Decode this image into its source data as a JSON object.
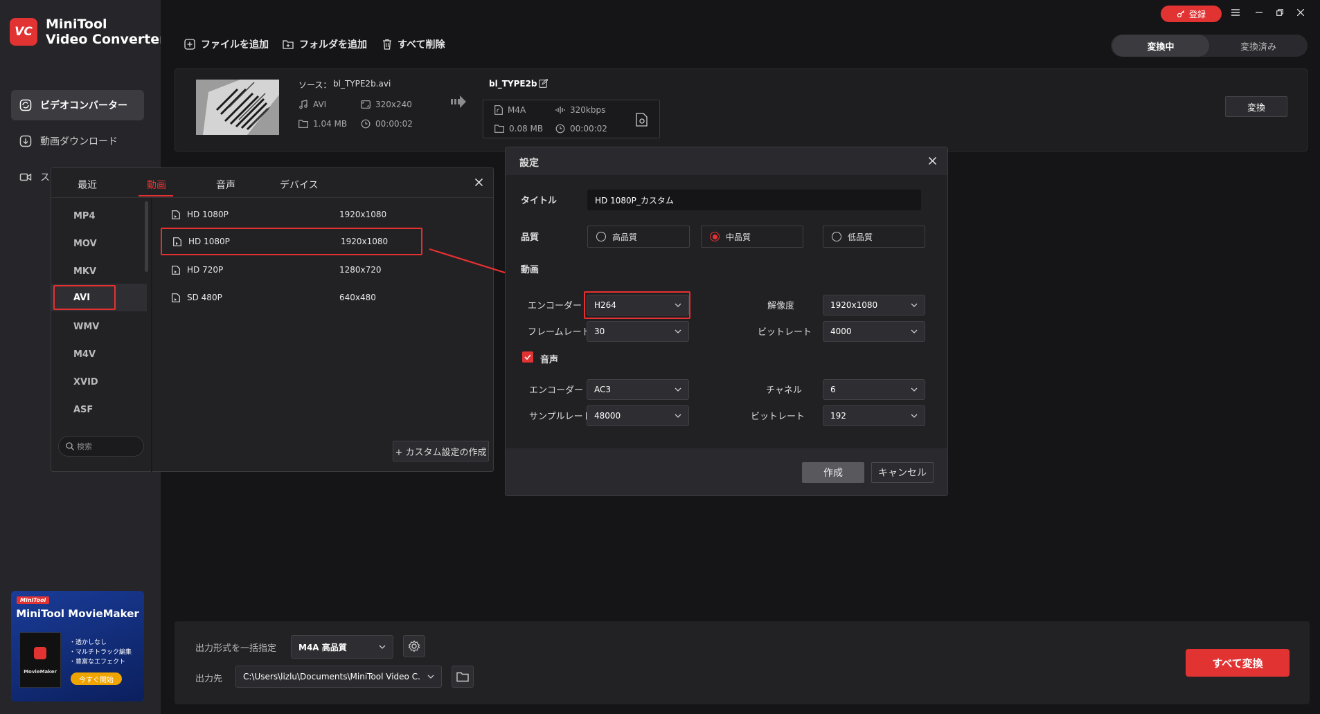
{
  "app": {
    "name_line1": "MiniTool",
    "name_line2": "Video Converter",
    "logo_text": "VC"
  },
  "sidebar": {
    "items": [
      {
        "label": "ビデオコンバーター",
        "active": true
      },
      {
        "label": "動画ダウンロード"
      },
      {
        "label": "ス"
      }
    ]
  },
  "promo": {
    "badge": "MiniTool",
    "title": "MiniTool MovieMaker",
    "features": [
      "・透かしなし",
      "・マルチトラック編集",
      "・豊富なエフェクト"
    ],
    "box_label": "MovieMaker",
    "cta": "今すぐ開始"
  },
  "titlebar": {
    "register": "登録"
  },
  "toolbar": {
    "add_file": "ファイルを追加",
    "add_folder": "フォルダを追加",
    "delete_all": "すべて削除"
  },
  "status_tabs": {
    "converting": "変換中",
    "converted": "変換済み"
  },
  "file": {
    "source_label": "ソース：",
    "source_name": "bl_TYPE2b.avi",
    "src_format": "AVI",
    "src_resolution": "320x240",
    "src_size": "1.04 MB",
    "src_duration": "00:00:02",
    "out_name": "bl_TYPE2b",
    "out_format": "M4A",
    "out_bitrate": "320kbps",
    "out_size": "0.08 MB",
    "out_duration": "00:00:02",
    "convert_button": "変換"
  },
  "format_dialog": {
    "tabs": [
      "最近",
      "動画",
      "音声",
      "デバイス"
    ],
    "active_tab": "動画",
    "formats": [
      "MP4",
      "MOV",
      "MKV",
      "AVI",
      "WMV",
      "M4V",
      "XVID",
      "ASF"
    ],
    "selected_format": "AVI",
    "presets": [
      {
        "name": "HD 1080P",
        "res": "1920x1080"
      },
      {
        "name": "HD 1080P",
        "res": "1920x1080"
      },
      {
        "name": "HD 720P",
        "res": "1280x720"
      },
      {
        "name": "SD 480P",
        "res": "640x480"
      }
    ],
    "search_placeholder": "検索",
    "custom_button": "+ カスタム設定の作成"
  },
  "settings": {
    "heading": "設定",
    "title_label": "タイトル",
    "title_value": "HD 1080P_カスタム",
    "quality_label": "品質",
    "quality_options": [
      "高品質",
      "中品質",
      "低品質"
    ],
    "quality_selected": "中品質",
    "video_label": "動画",
    "encoder_label": "エンコーダー",
    "encoder_value": "H264",
    "resolution_label": "解像度",
    "resolution_value": "1920x1080",
    "framerate_label": "フレームレート",
    "framerate_value": "30",
    "bitrate_label": "ビットレート",
    "bitrate_value": "4000",
    "audio_label": "音声",
    "audio_checked": true,
    "audio_encoder_label": "エンコーダー",
    "audio_encoder_value": "AC3",
    "channel_label": "チャネル",
    "channel_value": "6",
    "samplerate_label": "サンプルレート",
    "samplerate_value": "48000",
    "audio_bitrate_label": "ビットレート",
    "audio_bitrate_value": "192",
    "create_button": "作成",
    "cancel_button": "キャンセル"
  },
  "bottom": {
    "output_format_label": "出力形式を一括指定",
    "output_format_value": "M4A 高品質",
    "output_path_label": "出力先",
    "output_path_value": "C:\\Users\\lizlu\\Documents\\MiniTool Video C.",
    "convert_all": "すべて変換"
  },
  "colors": {
    "accent": "#e23333",
    "background": "#151517",
    "panel": "#222225"
  }
}
